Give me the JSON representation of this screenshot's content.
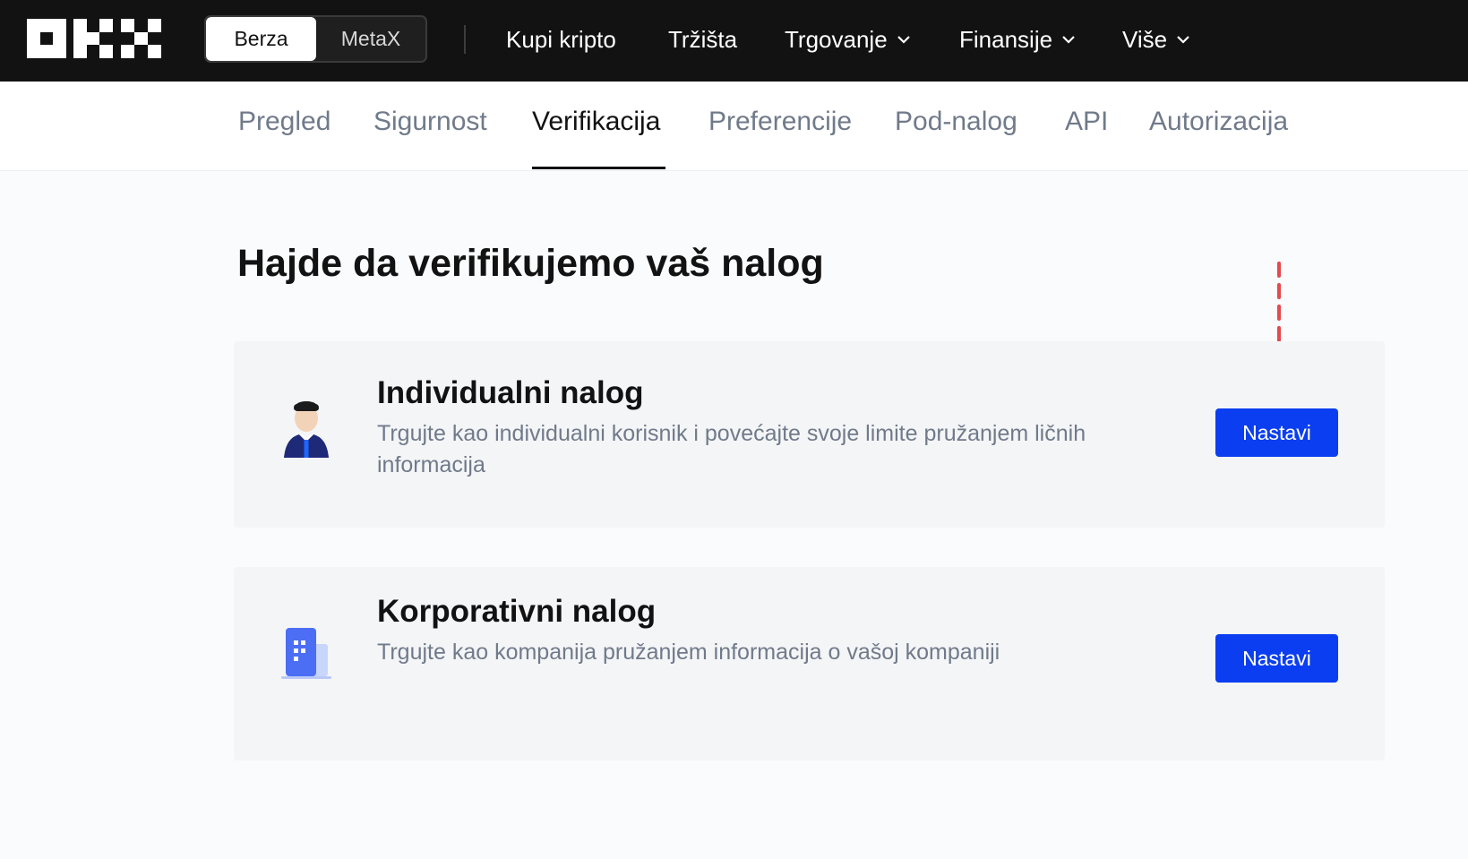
{
  "header": {
    "logo": "OKX",
    "mode_switch": [
      "Berza",
      "MetaX"
    ],
    "nav": [
      "Kupi kripto",
      "Tržišta",
      "Trgovanje",
      "Finansije",
      "Više"
    ]
  },
  "tabs": [
    "Pregled",
    "Sigurnost",
    "Verifikacija",
    "Preferencije",
    "Pod-nalog",
    "API",
    "Autorizacija"
  ],
  "page": {
    "title": "Hajde da verifikujemo vaš nalog"
  },
  "cards": [
    {
      "title": "Individualni nalog",
      "description": "Trgujte kao individualni korisnik i povećajte svoje limite pružanjem ličnih informacija",
      "button": "Nastavi",
      "icon": "person-icon"
    },
    {
      "title": "Korporativni nalog",
      "description": "Trgujte kao kompanija pružanjem informacija o vašoj kompaniji",
      "button": "Nastavi",
      "icon": "building-icon"
    }
  ],
  "colors": {
    "topbar": "#121212",
    "accent": "#0a3ef0",
    "annotation_arrow": "#e5484d",
    "card_bg": "#f4f5f7"
  }
}
